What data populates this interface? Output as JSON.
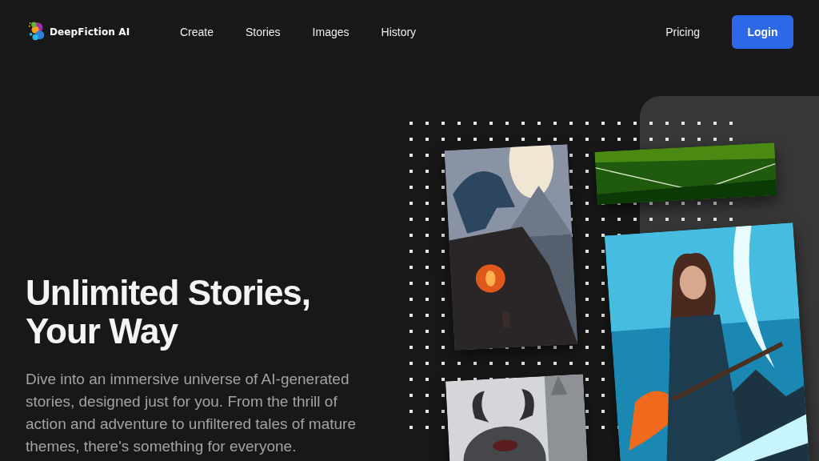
{
  "brand": {
    "name": "DeepFiction AI"
  },
  "nav": [
    {
      "label": "Create"
    },
    {
      "label": "Stories"
    },
    {
      "label": "Images"
    },
    {
      "label": "History"
    }
  ],
  "actions": {
    "pricing": "Pricing",
    "login": "Login"
  },
  "hero": {
    "title_lines": [
      "Unlimited Stories,",
      "Your Way"
    ],
    "description": "Dive into an immersive universe of AI-generated stories, designed just for you. From the thrill of action and adventure to unfiltered tales of mature themes, there's something for everyone."
  }
}
